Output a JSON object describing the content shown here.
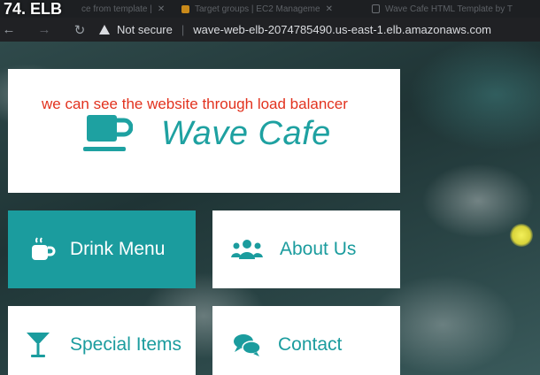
{
  "video_label": "74. ELB",
  "browser": {
    "tabs": [
      {
        "title": "ce from template |"
      },
      {
        "title": "Target groups | EC2 Manageme"
      },
      {
        "title": "Wave Cafe HTML Template by T"
      }
    ],
    "security_label": "Not secure",
    "url": "wave-web-elb-2074785490.us-east-1.elb.amazonaws.com"
  },
  "annotation": "we can see the website through load balancer",
  "site": {
    "brand": "Wave Cafe",
    "nav": {
      "drink_menu": "Drink Menu",
      "about_us": "About Us",
      "special_items": "Special Items",
      "contact": "Contact"
    }
  },
  "colors": {
    "accent": "#1b9c9e",
    "annotation": "#e2321e"
  }
}
